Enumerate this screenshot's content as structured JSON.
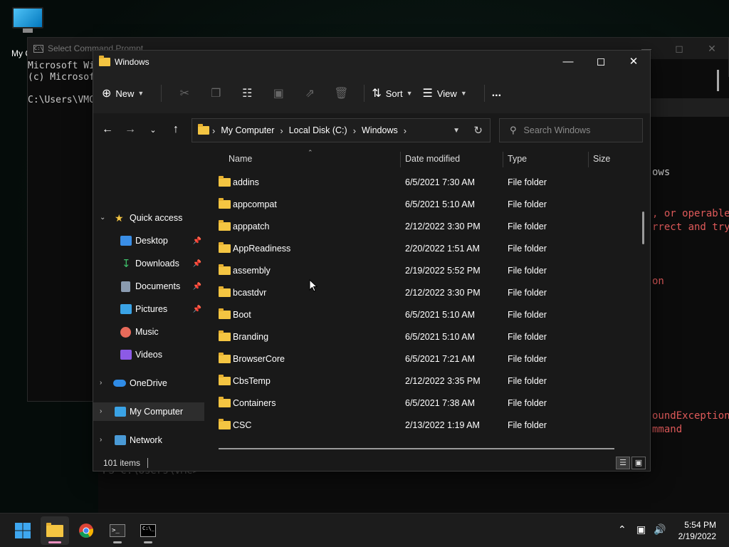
{
  "desktop": {
    "icon_label": "My Computer"
  },
  "cmd": {
    "title": "Select Command Prompt",
    "lines": [
      "Microsoft Windows",
      "(c) Microsoft Corporation",
      "",
      "C:\\Users\\VMC>"
    ]
  },
  "powershell": {
    "lines": [
      {
        "text": "ows",
        "color": "#cccccc"
      },
      {
        "text": ", or operable",
        "color": "#e05a5a"
      },
      {
        "text": "rrect and try",
        "color": "#e05a5a"
      },
      {
        "text": "on",
        "color": "#e05a5a"
      },
      {
        "text": "oundException",
        "color": "#e05a5a"
      },
      {
        "text": "mmand",
        "color": "#e05a5a"
      },
      {
        "text": "PS C:\\Users\\VMC>",
        "color": "#555555"
      }
    ]
  },
  "explorer": {
    "title": "Windows",
    "toolbar": {
      "new_label": "New",
      "sort_label": "Sort",
      "view_label": "View",
      "more_label": "..."
    },
    "address": {
      "crumbs": [
        "My Computer",
        "Local Disk (C:)",
        "Windows"
      ]
    },
    "search": {
      "placeholder": "Search Windows"
    },
    "sidebar": {
      "quick_access": "Quick access",
      "items": [
        {
          "label": "Desktop",
          "icon": "desktop-icon",
          "color": "#3a8ee6",
          "pinned": true
        },
        {
          "label": "Downloads",
          "icon": "download-icon",
          "color": "#3fbf6a",
          "pinned": true
        },
        {
          "label": "Documents",
          "icon": "documents-icon",
          "color": "#8a9bb0",
          "pinned": true
        },
        {
          "label": "Pictures",
          "icon": "pictures-icon",
          "color": "#3aa3e6",
          "pinned": true
        },
        {
          "label": "Music",
          "icon": "music-icon",
          "color": "#e86a5a",
          "pinned": false
        },
        {
          "label": "Videos",
          "icon": "videos-icon",
          "color": "#8c5ae6",
          "pinned": false
        }
      ],
      "onedrive": "OneDrive",
      "my_computer": "My Computer",
      "network": "Network"
    },
    "columns": {
      "name": "Name",
      "date": "Date modified",
      "type": "Type",
      "size": "Size"
    },
    "files": [
      {
        "name": "addins",
        "date": "6/5/2021 7:30 AM",
        "type": "File folder"
      },
      {
        "name": "appcompat",
        "date": "6/5/2021 5:10 AM",
        "type": "File folder"
      },
      {
        "name": "apppatch",
        "date": "2/12/2022 3:30 PM",
        "type": "File folder"
      },
      {
        "name": "AppReadiness",
        "date": "2/20/2022 1:51 AM",
        "type": "File folder"
      },
      {
        "name": "assembly",
        "date": "2/19/2022 5:52 PM",
        "type": "File folder"
      },
      {
        "name": "bcastdvr",
        "date": "2/12/2022 3:30 PM",
        "type": "File folder"
      },
      {
        "name": "Boot",
        "date": "6/5/2021 5:10 AM",
        "type": "File folder"
      },
      {
        "name": "Branding",
        "date": "6/5/2021 5:10 AM",
        "type": "File folder"
      },
      {
        "name": "BrowserCore",
        "date": "6/5/2021 7:21 AM",
        "type": "File folder"
      },
      {
        "name": "CbsTemp",
        "date": "2/12/2022 3:35 PM",
        "type": "File folder"
      },
      {
        "name": "Containers",
        "date": "6/5/2021 7:38 AM",
        "type": "File folder"
      },
      {
        "name": "CSC",
        "date": "2/13/2022 1:19 AM",
        "type": "File folder"
      }
    ],
    "status": {
      "item_count": "101 items"
    }
  },
  "taskbar": {
    "time": "5:54 PM",
    "date": "2/19/2022"
  }
}
